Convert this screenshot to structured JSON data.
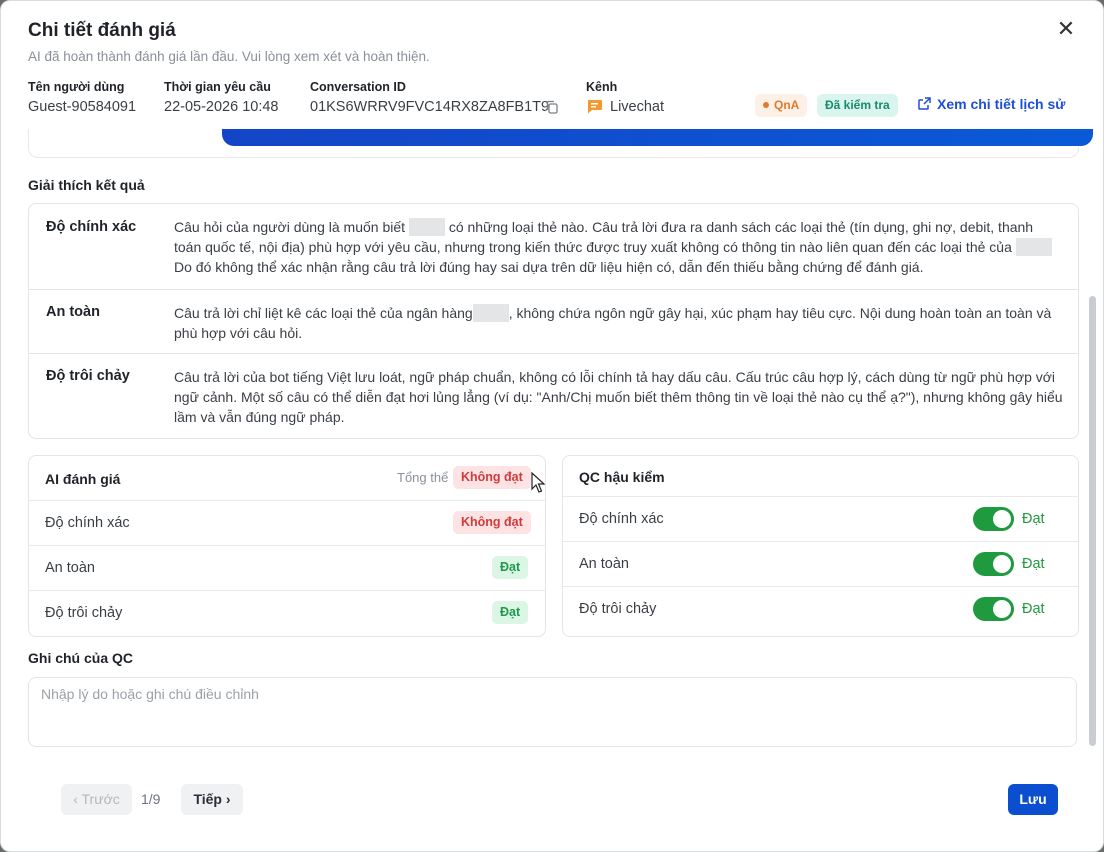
{
  "modal": {
    "title": "Chi tiết đánh giá",
    "subtitle": "AI đã hoàn thành đánh giá lần đầu. Vui lòng xem xét và hoàn thiện."
  },
  "meta": {
    "user_label": "Tên người dùng",
    "user_value": "Guest-90584091",
    "time_label": "Thời gian yêu cầu",
    "time_value": "22-05-2026 10:48",
    "conv_label": "Conversation ID",
    "conv_value": "01KS6WRRV9FVC14RX8ZA8FB1T9",
    "channel_label": "Kênh",
    "channel_value": "Livechat",
    "badge_qna": "QnA",
    "badge_checked": "Đã kiểm tra",
    "history_link": "Xem chi tiết lịch sử"
  },
  "explanation": {
    "title": "Giải thích kết quả",
    "rows": [
      {
        "label": "Độ chính xác",
        "text_a": "Câu hỏi của người dùng là muốn biết",
        "text_b": "có những loại thẻ nào. Câu trả lời đưa ra danh sách các loại thẻ (tín dụng, ghi nợ, debit, thanh toán quốc tế, nội địa) phù hợp với yêu cầu, nhưng trong kiến thức được truy xuất không có thông tin nào liên quan đến các loại thẻ của",
        "text_c": "Do đó không thể xác nhận rằng câu trả lời đúng hay sai dựa trên dữ liệu hiện có, dẫn đến thiếu bằng chứng để đánh giá."
      },
      {
        "label": "An toàn",
        "text_a": "Câu trả lời chỉ liệt kê các loại thẻ của ngân hàng",
        "text_b": ", không chứa ngôn ngữ gây hại, xúc phạm hay tiêu cực. Nội dung hoàn toàn an toàn và phù hợp với câu hỏi."
      },
      {
        "label": "Độ trôi chảy",
        "text": "Câu trả lời của bot tiếng Việt lưu loát, ngữ pháp chuẩn, không có lỗi chính tả hay dấu câu. Cấu trúc câu hợp lý, cách dùng từ ngữ phù hợp với ngữ cảnh. Một số câu có thể diễn đạt hơi lủng lẳng (ví dụ: \"Anh/Chị muốn biết thêm thông tin về loại thẻ nào cụ thể ạ?\"), nhưng không gây hiểu lầm và vẫn đúng ngữ pháp."
      }
    ]
  },
  "ai_eval": {
    "title": "AI đánh giá",
    "overall_label": "Tổng thể",
    "overall_value": "Không đạt",
    "rows": [
      {
        "label": "Độ chính xác",
        "result": "Không đạt"
      },
      {
        "label": "An toàn",
        "result": "Đạt"
      },
      {
        "label": "Độ trôi chảy",
        "result": "Đạt"
      }
    ]
  },
  "qc_eval": {
    "title": "QC hậu kiểm",
    "rows": [
      {
        "label": "Độ chính xác",
        "result": "Đạt",
        "on": true
      },
      {
        "label": "An toàn",
        "result": "Đạt",
        "on": true
      },
      {
        "label": "Độ trôi chảy",
        "result": "Đạt",
        "on": true
      }
    ]
  },
  "notes": {
    "title": "Ghi chú của QC",
    "placeholder": "Nhập lý do hoặc ghi chú điều chỉnh",
    "value": ""
  },
  "footer": {
    "prev_label": "‹ Trước",
    "page_indicator": "1/9",
    "next_label": "Tiếp ›",
    "save_label": "Lưu"
  },
  "colors": {
    "primary": "#0b4fd0",
    "fail": "#d13b3b",
    "pass": "#1f9a3e"
  }
}
